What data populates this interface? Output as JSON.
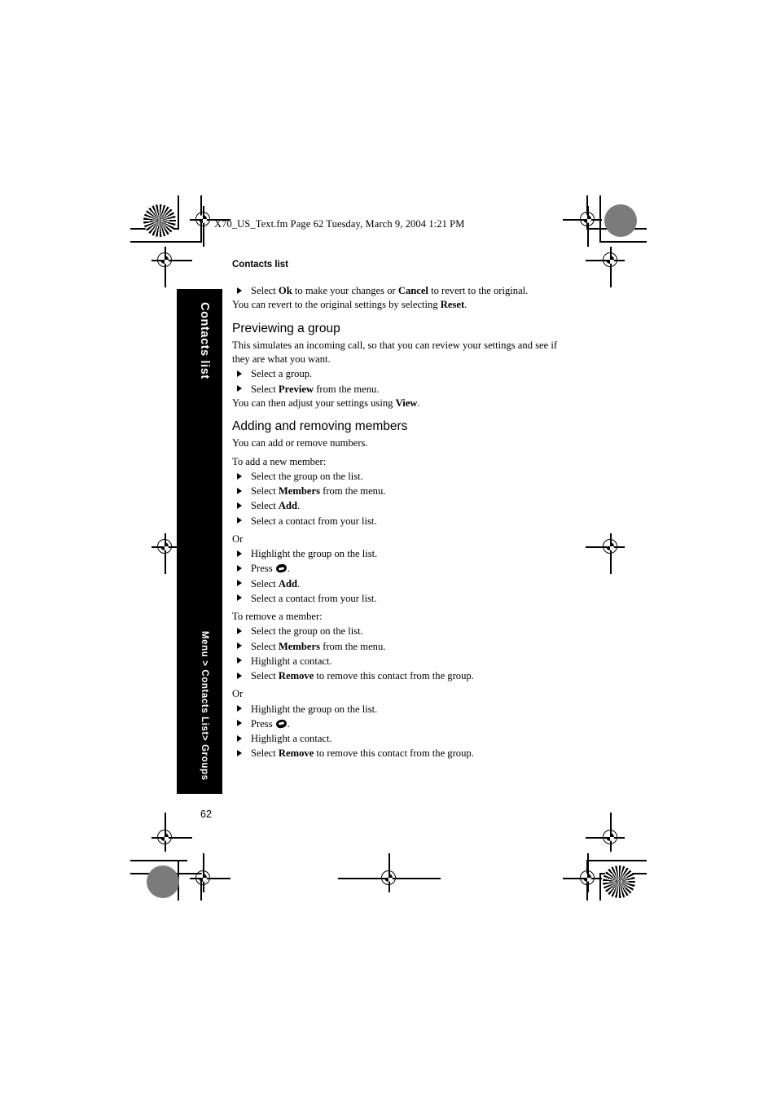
{
  "document": {
    "fm_header": "X70_US_Text.fm  Page 62  Tuesday, March 9, 2004  1:21 PM",
    "running_head": "Contacts list",
    "folio": "62"
  },
  "side_tab": {
    "top_label": "Contacts list",
    "bottom_label": "Menu > Contacts List> Groups"
  },
  "content": {
    "intro_bullet": {
      "pre": "Select ",
      "bold1": "Ok",
      "mid": " to make your changes or ",
      "bold2": "Cancel",
      "post": " to revert to the original."
    },
    "intro_para": {
      "pre": "You can revert to the original settings by selecting ",
      "bold": "Reset",
      "post": "."
    },
    "section_preview": {
      "heading": "Previewing a group",
      "body": "This simulates an incoming call, so that you can review your settings and see if they are what you want.",
      "bullets": [
        {
          "pre": "Select a group.",
          "bold": "",
          "post": ""
        },
        {
          "pre": "Select ",
          "bold": "Preview",
          "post": " from the menu."
        }
      ],
      "closing": {
        "pre": "You can then adjust your settings using ",
        "bold": "View",
        "post": "."
      }
    },
    "section_members": {
      "heading": "Adding and removing members",
      "body": "You can add or remove numbers.",
      "add_label": "To add a new member:",
      "add_bullets": [
        {
          "pre": "Select the group on the list.",
          "bold": "",
          "post": ""
        },
        {
          "pre": "Select ",
          "bold": "Members",
          "post": " from the menu."
        },
        {
          "pre": "Select ",
          "bold": "Add",
          "post": "."
        },
        {
          "pre": "Select a contact from your list.",
          "bold": "",
          "post": ""
        }
      ],
      "or_label_1": "Or",
      "add_alt_bullets": [
        {
          "pre": "Highlight the group on the list.",
          "bold": "",
          "post": "",
          "icon": ""
        },
        {
          "pre": "Press ",
          "bold": "",
          "post": ".",
          "icon": "menu-key-icon"
        },
        {
          "pre": "Select ",
          "bold": "Add",
          "post": ".",
          "icon": ""
        },
        {
          "pre": "Select a contact from your list.",
          "bold": "",
          "post": "",
          "icon": ""
        }
      ],
      "remove_label": "To remove a member:",
      "remove_bullets": [
        {
          "pre": "Select the group on the list.",
          "bold": "",
          "post": ""
        },
        {
          "pre": "Select ",
          "bold": "Members",
          "post": " from the menu."
        },
        {
          "pre": "Highlight a contact.",
          "bold": "",
          "post": ""
        },
        {
          "pre": "Select ",
          "bold": "Remove",
          "post": " to remove this contact from the group."
        }
      ],
      "or_label_2": "Or",
      "remove_alt_bullets": [
        {
          "pre": "Highlight the group on the list.",
          "bold": "",
          "post": "",
          "icon": ""
        },
        {
          "pre": "Press ",
          "bold": "",
          "post": ".",
          "icon": "menu-key-icon"
        },
        {
          "pre": "Highlight a contact.",
          "bold": "",
          "post": "",
          "icon": ""
        },
        {
          "pre": "Select ",
          "bold": "Remove",
          "post": " to remove this contact from the group.",
          "icon": ""
        }
      ]
    }
  },
  "prepress": {
    "colors": {
      "ink": "#000000",
      "patch_solid": "#7b7b7b"
    }
  }
}
